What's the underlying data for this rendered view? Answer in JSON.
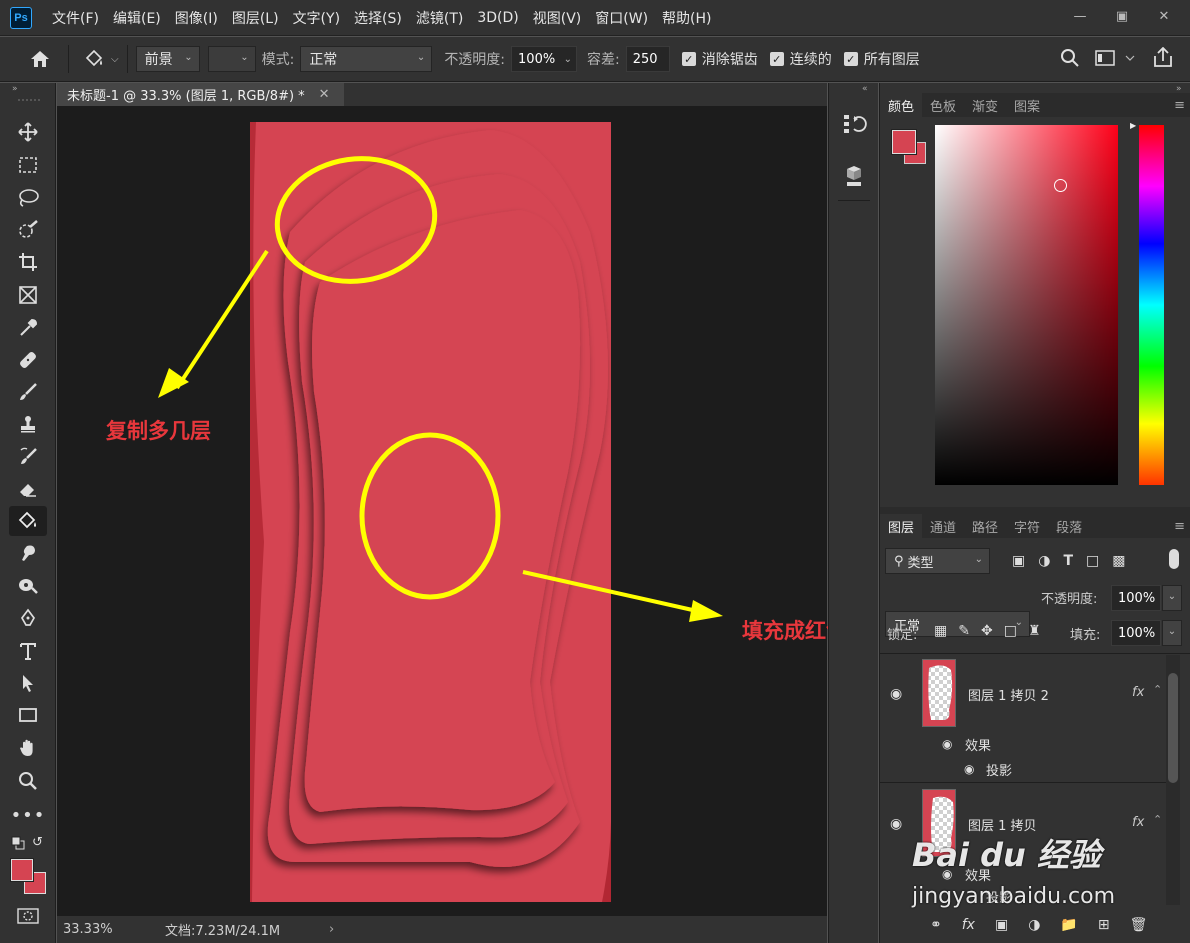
{
  "app": {
    "logo": "Ps"
  },
  "menu": [
    "文件(F)",
    "编辑(E)",
    "图像(I)",
    "图层(L)",
    "文字(Y)",
    "选择(S)",
    "滤镜(T)",
    "3D(D)",
    "视图(V)",
    "窗口(W)",
    "帮助(H)"
  ],
  "options": {
    "fill_source": "前景",
    "mode_label": "模式:",
    "mode_value": "正常",
    "opacity_label": "不透明度:",
    "opacity_value": "100%",
    "tolerance_label": "容差:",
    "tolerance_value": "250",
    "antialias_label": "消除锯齿",
    "contiguous_label": "连续的",
    "all_layers_label": "所有图层"
  },
  "document": {
    "tab_title": "未标题-1 @ 33.3% (图层 1, RGB/8#) *",
    "zoom": "33.33%",
    "doc_info": "文档:7.23M/24.1M"
  },
  "annotations": {
    "left": "复制多几层",
    "right": "填充成红色"
  },
  "color_panel": {
    "tabs": [
      "颜色",
      "色板",
      "渐变",
      "图案"
    ],
    "foreground": "#d54452",
    "background": "#d54452"
  },
  "layers_panel": {
    "tabs": [
      "图层",
      "通道",
      "路径",
      "字符",
      "段落"
    ],
    "filter_kind": "类型",
    "blend_mode": "正常",
    "opacity_label": "不透明度:",
    "opacity_value": "100%",
    "lock_label": "锁定:",
    "fill_label": "填充:",
    "fill_value": "100%",
    "layers": [
      {
        "name": "图层 1 拷贝 2",
        "fx": "fx",
        "effects_label": "效果",
        "effect": "投影"
      },
      {
        "name": "图层 1 拷贝",
        "fx": "fx",
        "effects_label": "效果",
        "effect": "投影"
      }
    ]
  },
  "watermark": {
    "brand": "Bai du 经验",
    "url": "jingyan.baidu.com"
  }
}
